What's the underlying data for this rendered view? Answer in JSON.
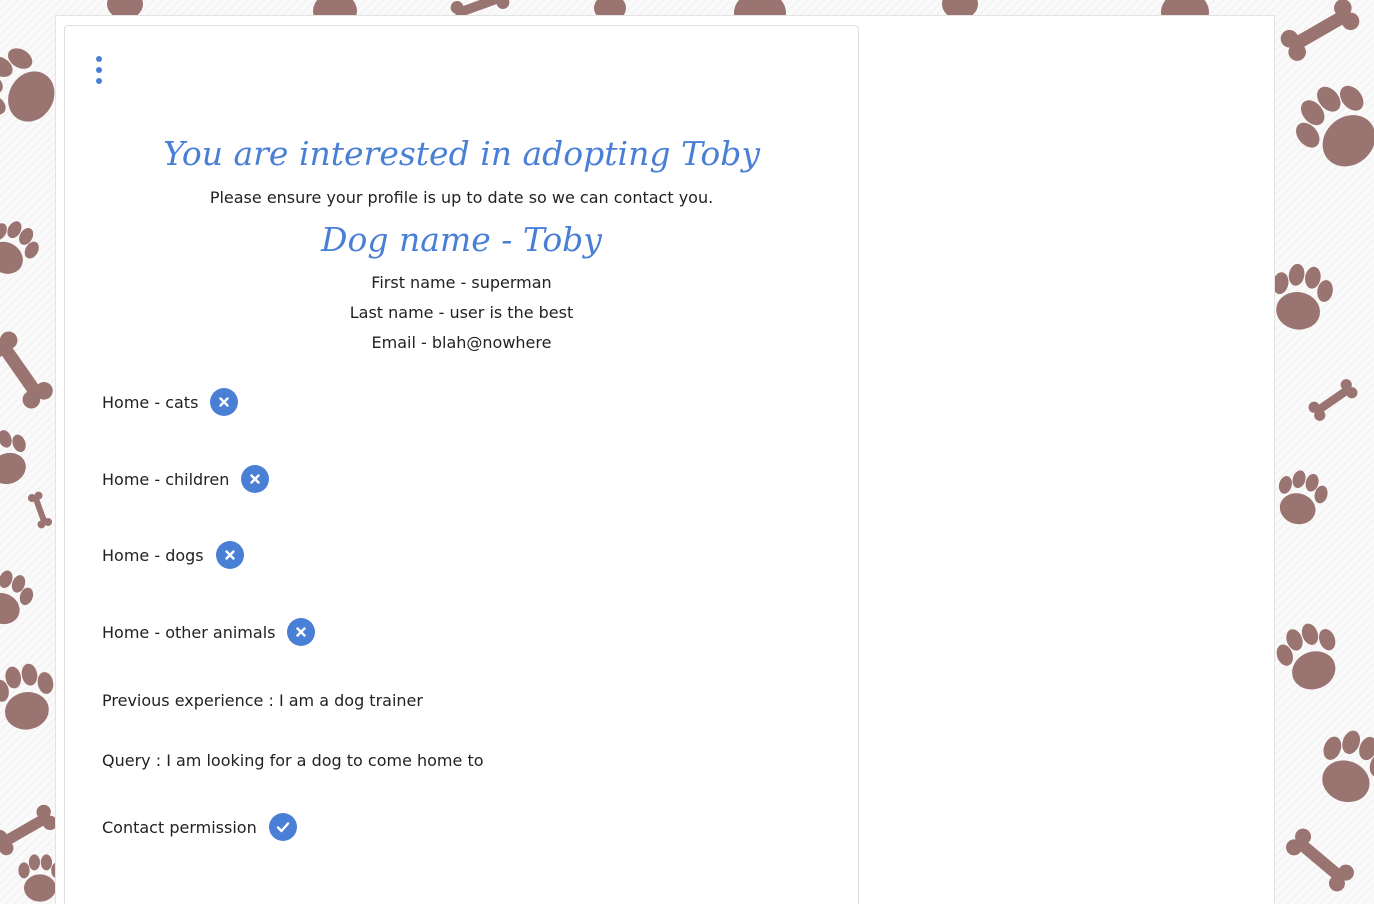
{
  "colors": {
    "accent": "#4a7fd6",
    "background_pattern": "#9a7470",
    "text": "#222222"
  },
  "background": {
    "pattern_icon": "paw-and-bone-icon"
  },
  "card": {
    "menu_icon": "kebab-menu-icon",
    "title": "You are interested in adopting Toby",
    "subtitle": "Please ensure your profile is up to date so we can contact you.",
    "dog_name": "Dog name - Toby",
    "first_name": "First name - superman",
    "last_name": "Last name - user is the best",
    "email": "Email - blah@nowhere",
    "home_rows": [
      {
        "label": "Home - cats",
        "status": "no",
        "icon": "cross-circle-icon"
      },
      {
        "label": "Home - children",
        "status": "no",
        "icon": "cross-circle-icon"
      },
      {
        "label": "Home - dogs",
        "status": "no",
        "icon": "cross-circle-icon"
      },
      {
        "label": "Home - other animals",
        "status": "no",
        "icon": "cross-circle-icon"
      }
    ],
    "previous_experience": "Previous experience : I am a dog trainer",
    "query": "Query : I am looking for a dog to come home to",
    "contact_permission": {
      "label": "Contact permission",
      "status": "yes",
      "icon": "check-circle-icon"
    }
  }
}
